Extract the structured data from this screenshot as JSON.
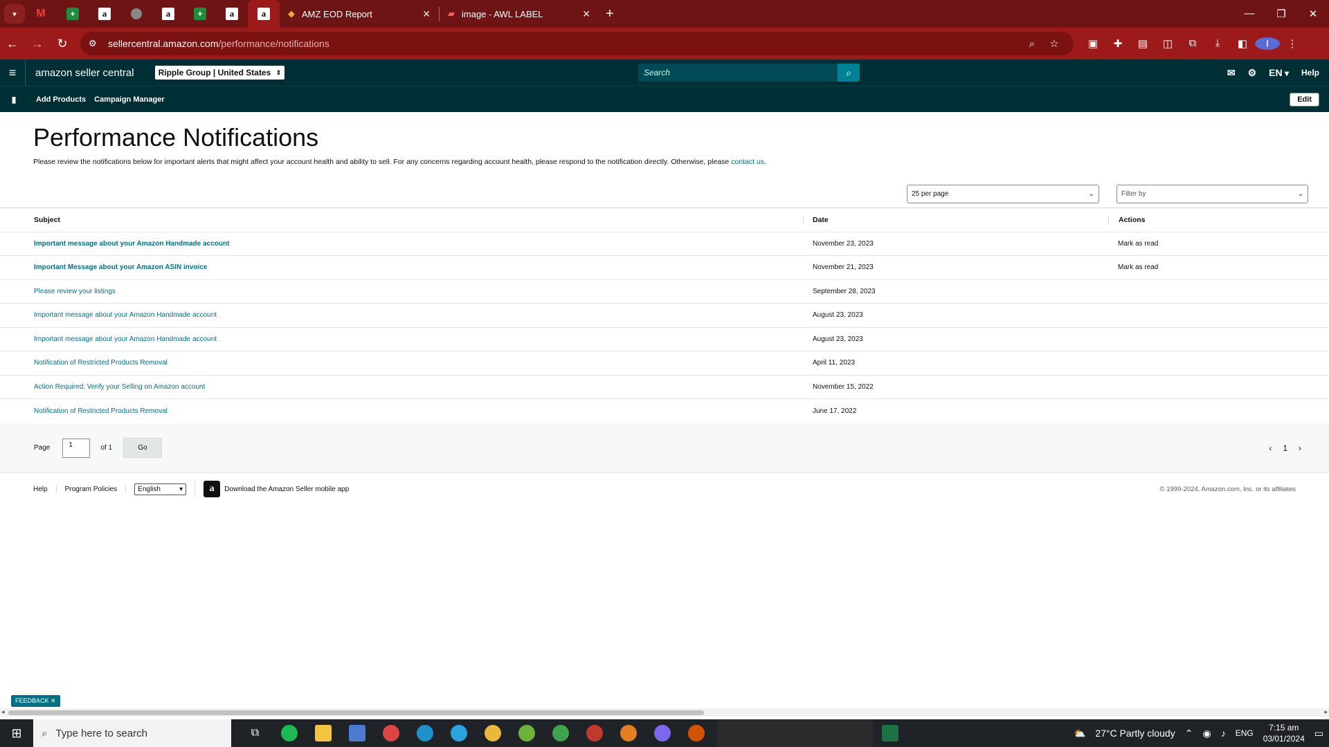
{
  "browser": {
    "tabs": [
      {
        "title": "AMZ EOD Report"
      },
      {
        "title": "image - AWL LABEL"
      }
    ],
    "url_host": "sellercentral.amazon.com",
    "url_path": "/performance/notifications"
  },
  "header": {
    "logo": "amazon seller central",
    "account": "Ripple Group | United States",
    "search_placeholder": "Search",
    "lang": "EN",
    "help": "Help"
  },
  "subnav": {
    "items": [
      "Add Products",
      "Campaign Manager"
    ],
    "edit": "Edit"
  },
  "page": {
    "title": "Performance Notifications",
    "intro": "Please review the notifications below for important alerts that might affect your account health and ability to sell. For any concerns regarding account health, please respond to the notification directly. Otherwise, please ",
    "intro_link": "contact us",
    "intro_end": "."
  },
  "controls": {
    "per_page": "25 per page",
    "filter_by": "Filter by"
  },
  "table": {
    "headers": {
      "subject": "Subject",
      "date": "Date",
      "actions": "Actions"
    },
    "rows": [
      {
        "subject": "Important message about your Amazon Handmade account",
        "date": "November 23, 2023",
        "action": "Mark as read"
      },
      {
        "subject": "Important Message about your Amazon ASIN invoice",
        "date": "November 21, 2023",
        "action": "Mark as read"
      },
      {
        "subject": "Please review your listings",
        "date": "September 28, 2023",
        "action": ""
      },
      {
        "subject": "Important message about your Amazon Handmade account",
        "date": "August 23, 2023",
        "action": ""
      },
      {
        "subject": "Important message about your Amazon Handmade account",
        "date": "August 23, 2023",
        "action": ""
      },
      {
        "subject": "Notification of Restricted Products Removal",
        "date": "April 11, 2023",
        "action": ""
      },
      {
        "subject": "Action Required: Verify your Selling on Amazon account",
        "date": "November 15, 2022",
        "action": ""
      },
      {
        "subject": "Notification of Restricted Products Removal",
        "date": "June 17, 2022",
        "action": ""
      }
    ]
  },
  "pager": {
    "page_label": "Page",
    "page_value": "1",
    "of_label": "of 1",
    "go": "Go",
    "current": "1"
  },
  "footer": {
    "help": "Help",
    "policies": "Program Policies",
    "language": "English",
    "app_link": "Download the Amazon Seller mobile app",
    "copyright": "© 1999-2024, Amazon.com, Inc. or its affiliates"
  },
  "feedback": "FEEDBACK",
  "taskbar": {
    "search_placeholder": "Type here to search",
    "weather": "27°C  Partly cloudy",
    "lang": "ENG",
    "time": "7:15 am",
    "date": "03/01/2024"
  },
  "colors": {
    "chrome_dark": "#6e1414",
    "chrome_addr": "#9d1a1a",
    "sc_header": "#002f36",
    "link": "#007185"
  }
}
